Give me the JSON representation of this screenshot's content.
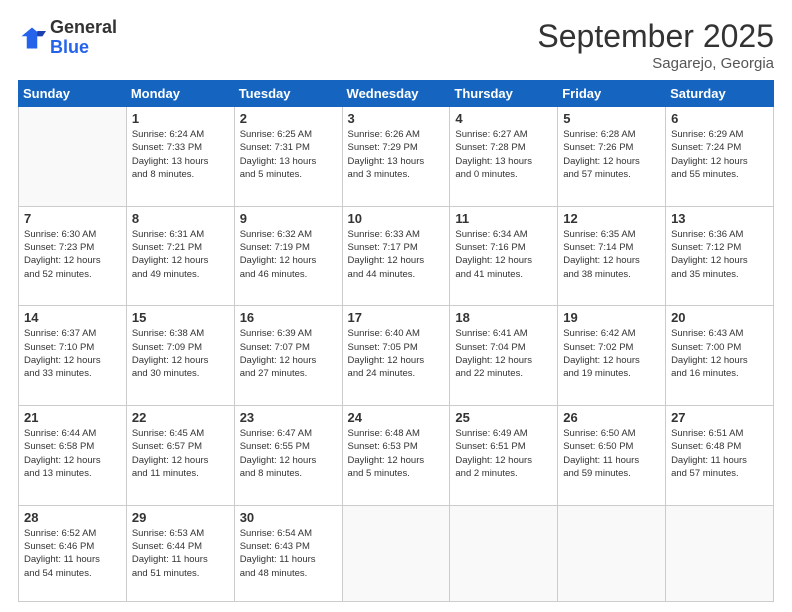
{
  "header": {
    "logo_general": "General",
    "logo_blue": "Blue",
    "month_title": "September 2025",
    "location": "Sagarejo, Georgia"
  },
  "weekdays": [
    "Sunday",
    "Monday",
    "Tuesday",
    "Wednesday",
    "Thursday",
    "Friday",
    "Saturday"
  ],
  "weeks": [
    [
      {
        "day": "",
        "info": ""
      },
      {
        "day": "1",
        "info": "Sunrise: 6:24 AM\nSunset: 7:33 PM\nDaylight: 13 hours\nand 8 minutes."
      },
      {
        "day": "2",
        "info": "Sunrise: 6:25 AM\nSunset: 7:31 PM\nDaylight: 13 hours\nand 5 minutes."
      },
      {
        "day": "3",
        "info": "Sunrise: 6:26 AM\nSunset: 7:29 PM\nDaylight: 13 hours\nand 3 minutes."
      },
      {
        "day": "4",
        "info": "Sunrise: 6:27 AM\nSunset: 7:28 PM\nDaylight: 13 hours\nand 0 minutes."
      },
      {
        "day": "5",
        "info": "Sunrise: 6:28 AM\nSunset: 7:26 PM\nDaylight: 12 hours\nand 57 minutes."
      },
      {
        "day": "6",
        "info": "Sunrise: 6:29 AM\nSunset: 7:24 PM\nDaylight: 12 hours\nand 55 minutes."
      }
    ],
    [
      {
        "day": "7",
        "info": "Sunrise: 6:30 AM\nSunset: 7:23 PM\nDaylight: 12 hours\nand 52 minutes."
      },
      {
        "day": "8",
        "info": "Sunrise: 6:31 AM\nSunset: 7:21 PM\nDaylight: 12 hours\nand 49 minutes."
      },
      {
        "day": "9",
        "info": "Sunrise: 6:32 AM\nSunset: 7:19 PM\nDaylight: 12 hours\nand 46 minutes."
      },
      {
        "day": "10",
        "info": "Sunrise: 6:33 AM\nSunset: 7:17 PM\nDaylight: 12 hours\nand 44 minutes."
      },
      {
        "day": "11",
        "info": "Sunrise: 6:34 AM\nSunset: 7:16 PM\nDaylight: 12 hours\nand 41 minutes."
      },
      {
        "day": "12",
        "info": "Sunrise: 6:35 AM\nSunset: 7:14 PM\nDaylight: 12 hours\nand 38 minutes."
      },
      {
        "day": "13",
        "info": "Sunrise: 6:36 AM\nSunset: 7:12 PM\nDaylight: 12 hours\nand 35 minutes."
      }
    ],
    [
      {
        "day": "14",
        "info": "Sunrise: 6:37 AM\nSunset: 7:10 PM\nDaylight: 12 hours\nand 33 minutes."
      },
      {
        "day": "15",
        "info": "Sunrise: 6:38 AM\nSunset: 7:09 PM\nDaylight: 12 hours\nand 30 minutes."
      },
      {
        "day": "16",
        "info": "Sunrise: 6:39 AM\nSunset: 7:07 PM\nDaylight: 12 hours\nand 27 minutes."
      },
      {
        "day": "17",
        "info": "Sunrise: 6:40 AM\nSunset: 7:05 PM\nDaylight: 12 hours\nand 24 minutes."
      },
      {
        "day": "18",
        "info": "Sunrise: 6:41 AM\nSunset: 7:04 PM\nDaylight: 12 hours\nand 22 minutes."
      },
      {
        "day": "19",
        "info": "Sunrise: 6:42 AM\nSunset: 7:02 PM\nDaylight: 12 hours\nand 19 minutes."
      },
      {
        "day": "20",
        "info": "Sunrise: 6:43 AM\nSunset: 7:00 PM\nDaylight: 12 hours\nand 16 minutes."
      }
    ],
    [
      {
        "day": "21",
        "info": "Sunrise: 6:44 AM\nSunset: 6:58 PM\nDaylight: 12 hours\nand 13 minutes."
      },
      {
        "day": "22",
        "info": "Sunrise: 6:45 AM\nSunset: 6:57 PM\nDaylight: 12 hours\nand 11 minutes."
      },
      {
        "day": "23",
        "info": "Sunrise: 6:47 AM\nSunset: 6:55 PM\nDaylight: 12 hours\nand 8 minutes."
      },
      {
        "day": "24",
        "info": "Sunrise: 6:48 AM\nSunset: 6:53 PM\nDaylight: 12 hours\nand 5 minutes."
      },
      {
        "day": "25",
        "info": "Sunrise: 6:49 AM\nSunset: 6:51 PM\nDaylight: 12 hours\nand 2 minutes."
      },
      {
        "day": "26",
        "info": "Sunrise: 6:50 AM\nSunset: 6:50 PM\nDaylight: 11 hours\nand 59 minutes."
      },
      {
        "day": "27",
        "info": "Sunrise: 6:51 AM\nSunset: 6:48 PM\nDaylight: 11 hours\nand 57 minutes."
      }
    ],
    [
      {
        "day": "28",
        "info": "Sunrise: 6:52 AM\nSunset: 6:46 PM\nDaylight: 11 hours\nand 54 minutes."
      },
      {
        "day": "29",
        "info": "Sunrise: 6:53 AM\nSunset: 6:44 PM\nDaylight: 11 hours\nand 51 minutes."
      },
      {
        "day": "30",
        "info": "Sunrise: 6:54 AM\nSunset: 6:43 PM\nDaylight: 11 hours\nand 48 minutes."
      },
      {
        "day": "",
        "info": ""
      },
      {
        "day": "",
        "info": ""
      },
      {
        "day": "",
        "info": ""
      },
      {
        "day": "",
        "info": ""
      }
    ]
  ]
}
